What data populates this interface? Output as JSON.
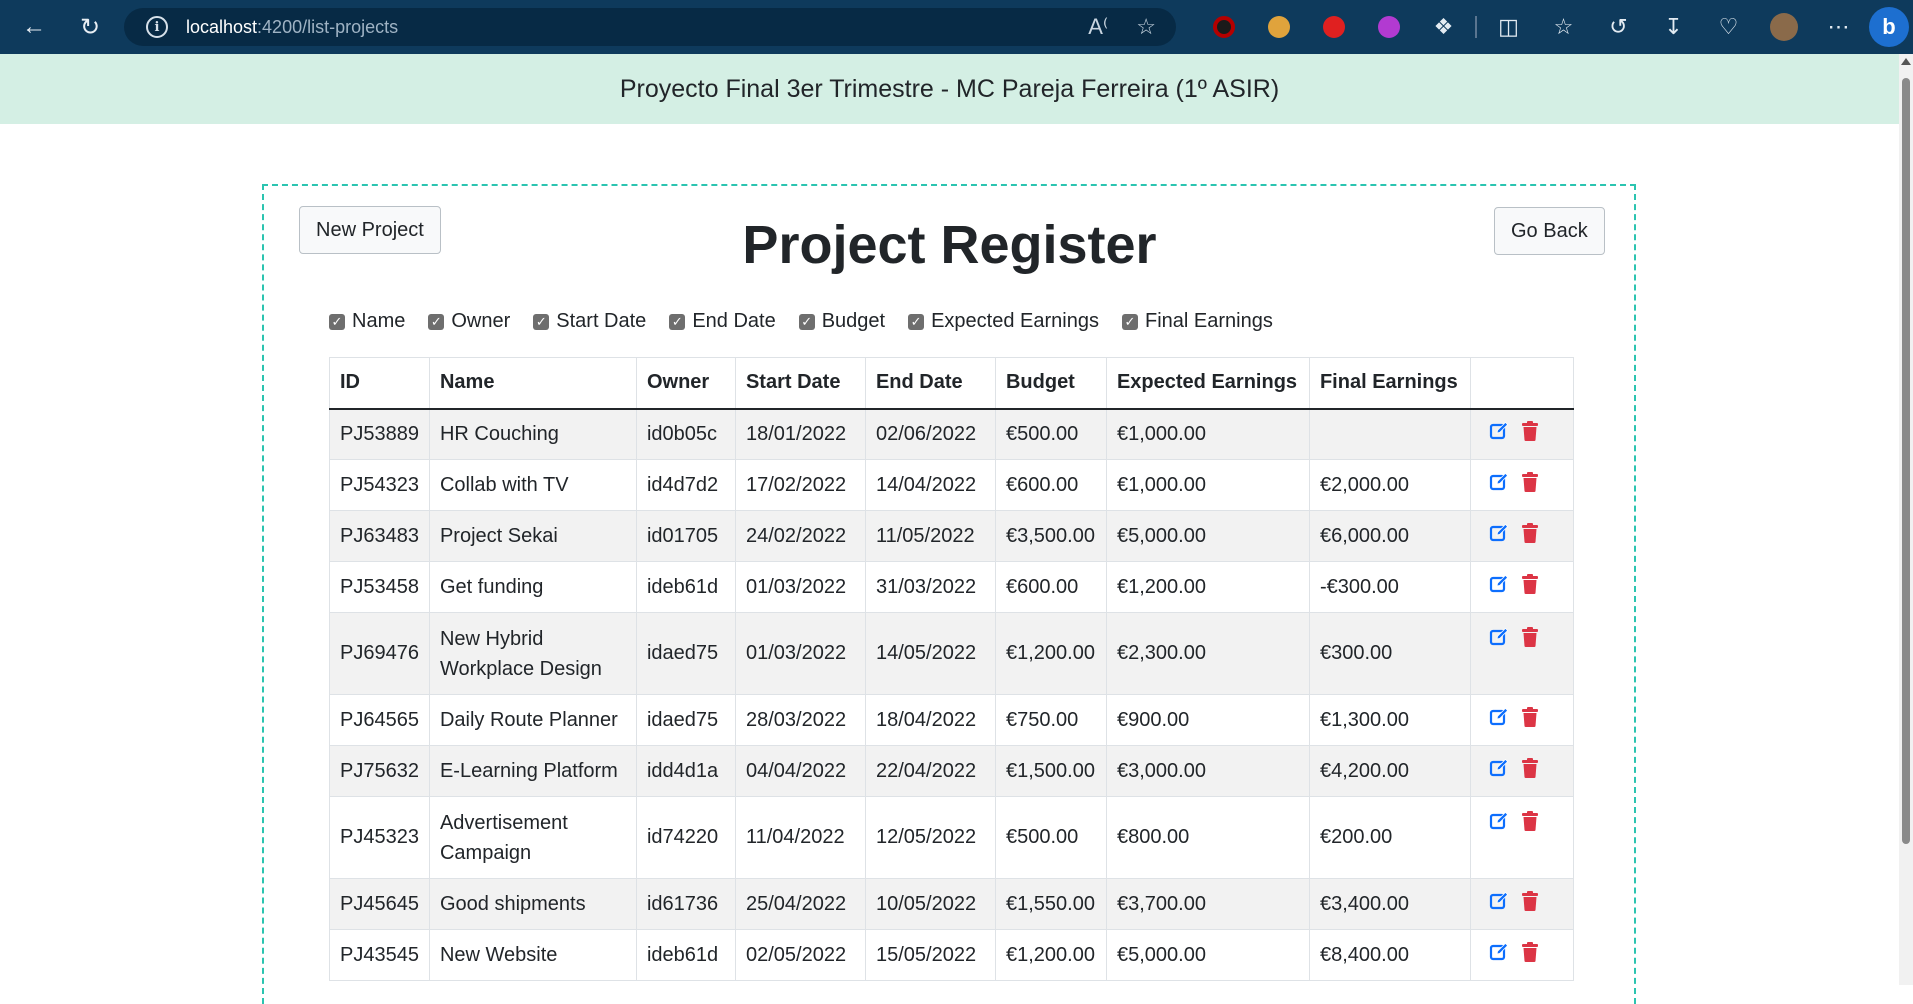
{
  "browser": {
    "url_host": "localhost",
    "url_path": ":4200/list-projects"
  },
  "header": {
    "title": "Proyecto Final 3er Trimestre - MC Pareja Ferreira (1º ASIR)"
  },
  "toolbar": {
    "new_label": "New Project",
    "back_label": "Go Back"
  },
  "page_title": "Project Register",
  "filters": [
    "Name",
    "Owner",
    "Start Date",
    "End Date",
    "Budget",
    "Expected Earnings",
    "Final Earnings"
  ],
  "table": {
    "columns": [
      "ID",
      "Name",
      "Owner",
      "Start Date",
      "End Date",
      "Budget",
      "Expected Earnings",
      "Final Earnings",
      ""
    ],
    "rows": [
      {
        "id": "PJ53889",
        "name": "HR Couching",
        "owner": "id0b05c",
        "start": "18/01/2022",
        "end": "02/06/2022",
        "budget": "€500.00",
        "expected": "€1,000.00",
        "final": ""
      },
      {
        "id": "PJ54323",
        "name": "Collab with TV",
        "owner": "id4d7d2",
        "start": "17/02/2022",
        "end": "14/04/2022",
        "budget": "€600.00",
        "expected": "€1,000.00",
        "final": "€2,000.00"
      },
      {
        "id": "PJ63483",
        "name": "Project Sekai",
        "owner": "id01705",
        "start": "24/02/2022",
        "end": "11/05/2022",
        "budget": "€3,500.00",
        "expected": "€5,000.00",
        "final": "€6,000.00"
      },
      {
        "id": "PJ53458",
        "name": "Get funding",
        "owner": "ideb61d",
        "start": "01/03/2022",
        "end": "31/03/2022",
        "budget": "€600.00",
        "expected": "€1,200.00",
        "final": "-€300.00"
      },
      {
        "id": "PJ69476",
        "name": "New Hybrid Workplace Design",
        "owner": "idaed75",
        "start": "01/03/2022",
        "end": "14/05/2022",
        "budget": "€1,200.00",
        "expected": "€2,300.00",
        "final": "€300.00"
      },
      {
        "id": "PJ64565",
        "name": "Daily Route Planner",
        "owner": "idaed75",
        "start": "28/03/2022",
        "end": "18/04/2022",
        "budget": "€750.00",
        "expected": "€900.00",
        "final": "€1,300.00"
      },
      {
        "id": "PJ75632",
        "name": "E-Learning Platform",
        "owner": "idd4d1a",
        "start": "04/04/2022",
        "end": "22/04/2022",
        "budget": "€1,500.00",
        "expected": "€3,000.00",
        "final": "€4,200.00"
      },
      {
        "id": "PJ45323",
        "name": "Advertisement Campaign",
        "owner": "id74220",
        "start": "11/04/2022",
        "end": "12/05/2022",
        "budget": "€500.00",
        "expected": "€800.00",
        "final": "€200.00"
      },
      {
        "id": "PJ45645",
        "name": "Good shipments",
        "owner": "id61736",
        "start": "25/04/2022",
        "end": "10/05/2022",
        "budget": "€1,550.00",
        "expected": "€3,700.00",
        "final": "€3,400.00"
      },
      {
        "id": "PJ43545",
        "name": "New Website",
        "owner": "ideb61d",
        "start": "02/05/2022",
        "end": "15/05/2022",
        "budget": "€1,200.00",
        "expected": "€5,000.00",
        "final": "€8,400.00"
      }
    ]
  },
  "icons": {
    "edit": "edit-icon",
    "delete": "trash-icon"
  },
  "colors": {
    "header_bg": "#d4efe4",
    "frame_border": "#2bc4b0",
    "edit_icon": "#0d6efd",
    "delete_icon": "#dc3545"
  }
}
